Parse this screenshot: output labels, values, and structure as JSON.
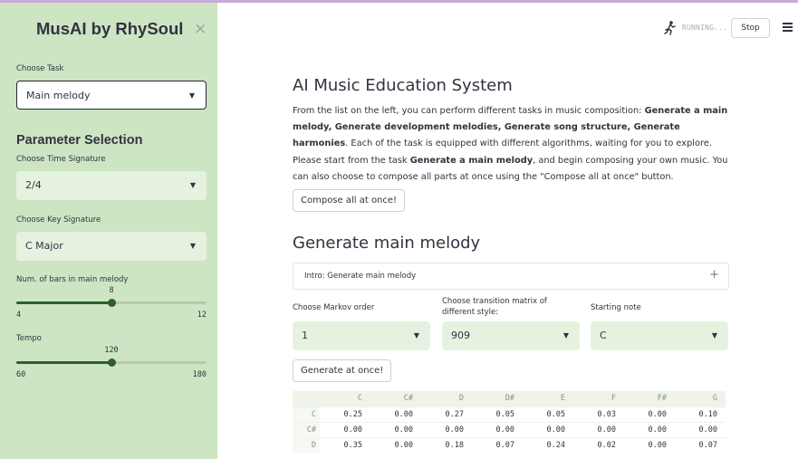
{
  "sidebar": {
    "title": "MusAI by RhySoul",
    "close_icon": "×",
    "task_label": "Choose Task",
    "task_value": "Main melody",
    "heading": "Parameter Selection",
    "time_sig_label": "Choose Time Signature",
    "time_sig_value": "2/4",
    "key_sig_label": "Choose Key Signature",
    "key_sig_value": "C Major",
    "bars": {
      "label": "Num. of bars in main melody",
      "value": 8,
      "min": 4,
      "max": 12,
      "value_text": "8",
      "min_text": "4",
      "max_text": "12"
    },
    "tempo": {
      "label": "Tempo",
      "value": 120,
      "min": 60,
      "max": 180,
      "value_text": "120",
      "min_text": "60",
      "max_text": "180"
    }
  },
  "header": {
    "status_icon": "running-man-icon",
    "status": "RUNNING...",
    "stop": "Stop",
    "menu_icon": "hamburger-menu-icon"
  },
  "main": {
    "title": "AI Music Education System",
    "intro": {
      "t1": "From the list on the left, you can perform different tasks in music composition: ",
      "b1": "Generate a main melody, Generate development melodies, Generate song structure, Generate harmonies",
      "t2": ". Each of the task is equipped with different algorithms, waiting for you to explore. Please start from the task ",
      "b2": "Generate a main melody",
      "t3": ", and begin composing your own music. You can also choose to compose all parts at once using the \"Compose all at once\" button."
    },
    "compose_button": "Compose all at once!",
    "section_title": "Generate main melody",
    "expander_label": "Intro: Generate main melody",
    "expander_icon": "+",
    "markov_label": "Choose Markov order",
    "markov_value": "1",
    "matrix_label": "Choose transition matrix of different style:",
    "matrix_value": "909",
    "start_label": "Starting note",
    "start_value": "C",
    "generate_button": "Generate at once!"
  },
  "table": {
    "columns": [
      "C",
      "C#",
      "D",
      "D#",
      "E",
      "F",
      "F#",
      "G"
    ],
    "rows": [
      {
        "label": "C",
        "cells": [
          "0.25",
          "0.00",
          "0.27",
          "0.05",
          "0.05",
          "0.03",
          "0.00",
          "0.10"
        ]
      },
      {
        "label": "C#",
        "cells": [
          "0.00",
          "0.00",
          "0.00",
          "0.00",
          "0.00",
          "0.00",
          "0.00",
          "0.00"
        ]
      },
      {
        "label": "D",
        "cells": [
          "0.35",
          "0.00",
          "0.18",
          "0.07",
          "0.24",
          "0.02",
          "0.00",
          "0.07"
        ]
      }
    ]
  }
}
